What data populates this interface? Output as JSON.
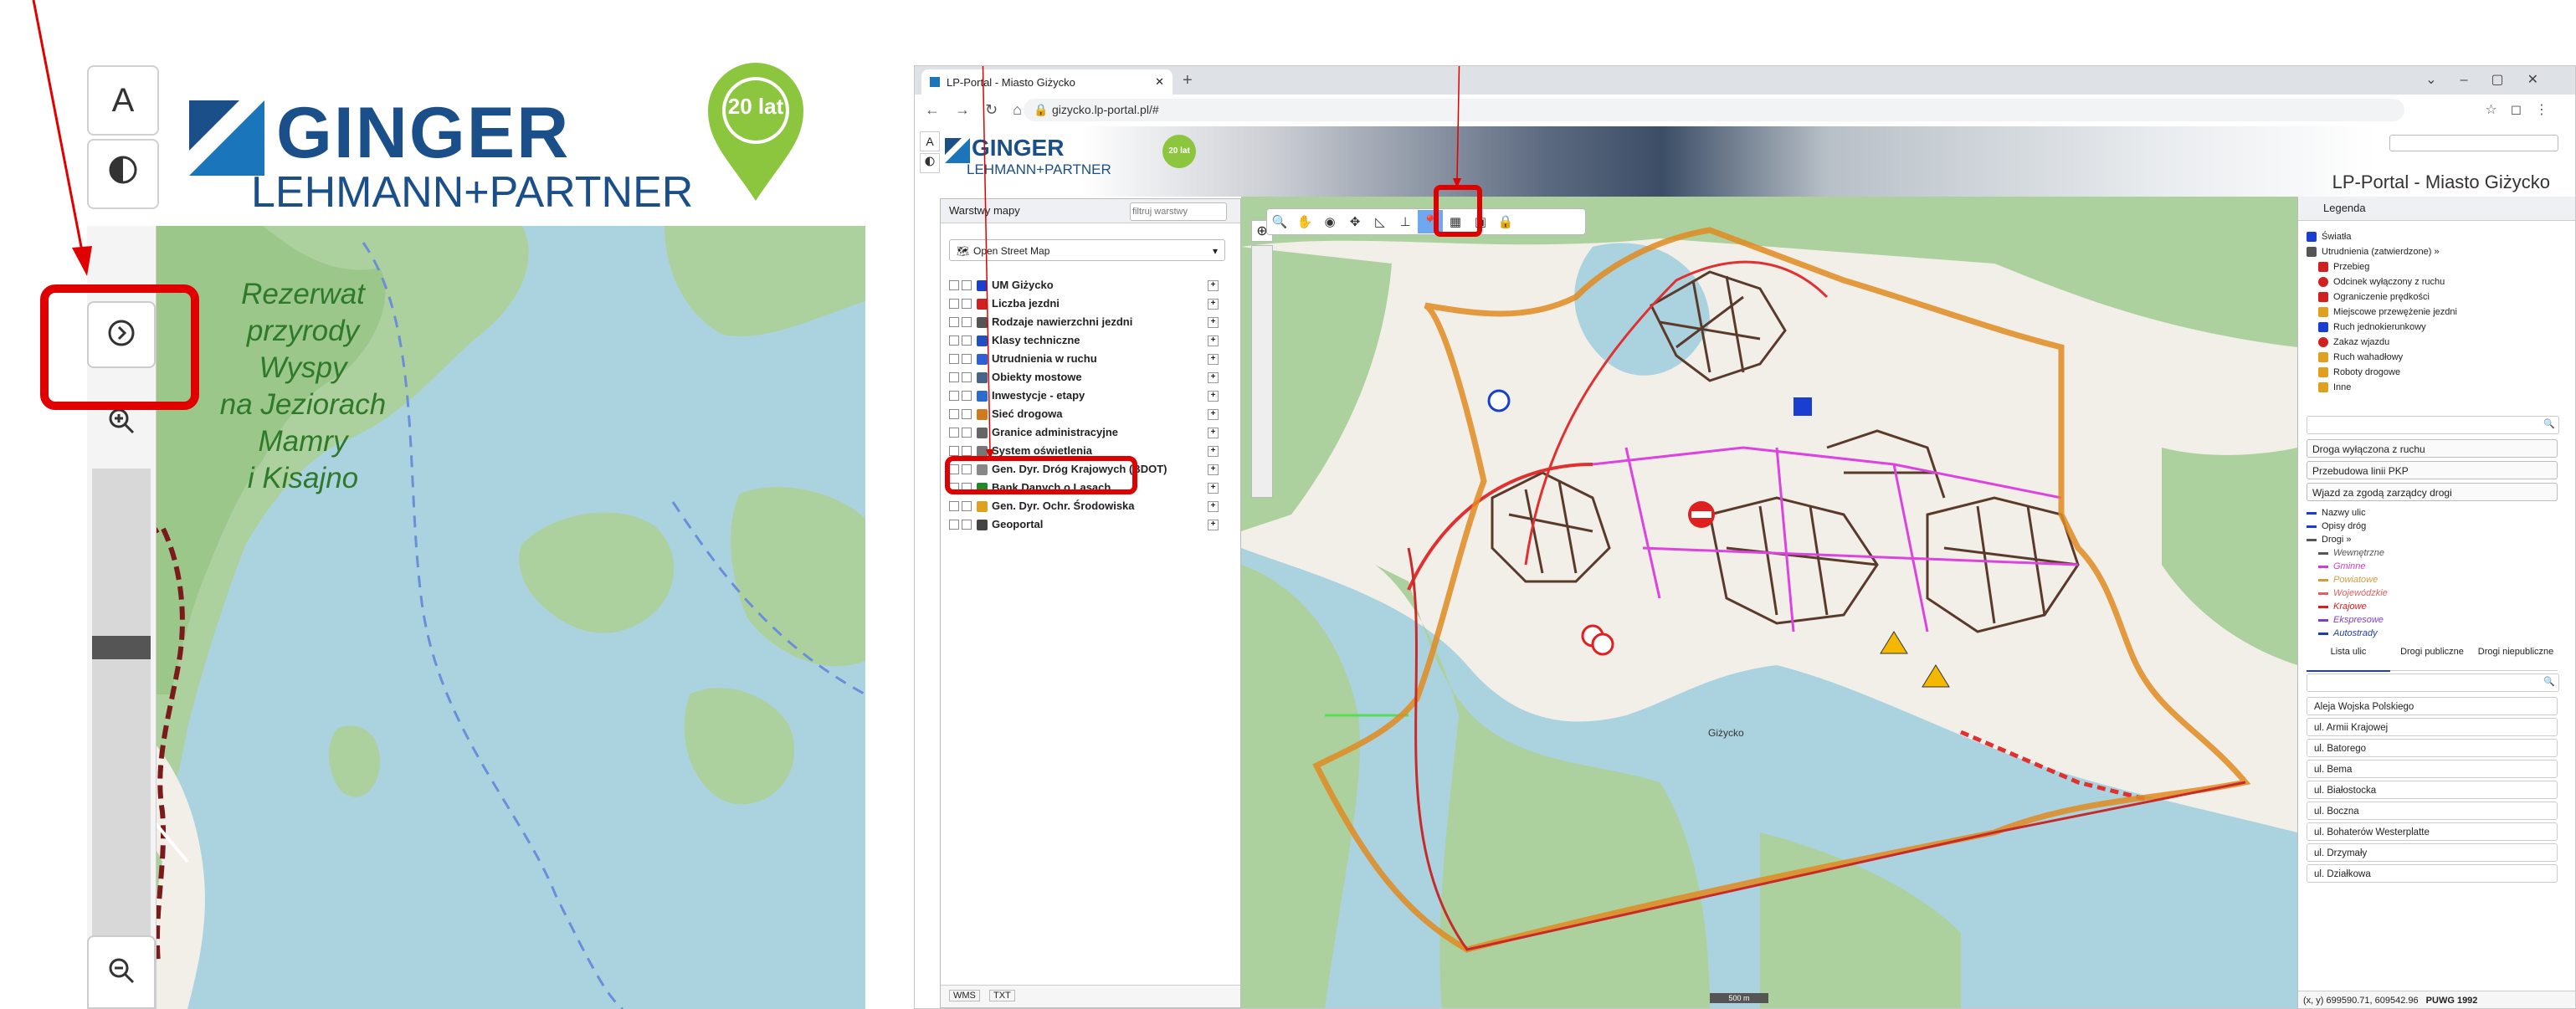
{
  "zoom": {
    "font_button": "A",
    "contrast_icon": "contrast-icon",
    "expand_icon": "chevron-right-circle-icon",
    "zoom_in_icon": "zoom-in-icon",
    "zoom_out_icon": "zoom-out-icon",
    "logo_line1": "GINGER",
    "logo_line2": "LEHMANN+PARTNER",
    "badge": "20 lat",
    "map_label": [
      "Rezerwat",
      "przyrody",
      "Wyspy",
      "na Jeziorach",
      "Mamry",
      "i Kisajno"
    ]
  },
  "browser": {
    "tab_title": "LP-Portal - Miasto Giżycko",
    "url": "gizycko.lp-portal.pl/#",
    "app_title": "LP-Portal - Miasto Giżycko"
  },
  "left_panel": {
    "title": "Warstwy mapy",
    "filter_placeholder": "filtruj warstwy",
    "basemap": "Open Street Map",
    "layers": [
      {
        "label": "UM Giżycko",
        "color": "#1a3fd0"
      },
      {
        "label": "Liczba jezdni",
        "color": "#d02020"
      },
      {
        "label": "Rodzaje nawierzchni jezdni",
        "color": "#555555"
      },
      {
        "label": "Klasy techniczne",
        "color": "#2050c0"
      },
      {
        "label": "Utrudnienia w ruchu",
        "color": "#2e5fd6"
      },
      {
        "label": "Obiekty mostowe",
        "color": "#446688"
      },
      {
        "label": "Inwestycje - etapy",
        "color": "#2b6cd0"
      },
      {
        "label": "Sieć drogowa",
        "color": "#d07a20"
      },
      {
        "label": "Granice administracyjne",
        "color": "#666666"
      },
      {
        "label": "System oświetlenia",
        "color": "#777777"
      },
      {
        "label": "Gen. Dyr. Dróg Krajowych (BDOT)",
        "color": "#888888"
      },
      {
        "label": "Bank Danych o Lasach",
        "color": "#1f8a2a"
      },
      {
        "label": "Gen. Dyr. Ochr. Środowiska",
        "color": "#e0a020"
      },
      {
        "label": "Geoportal",
        "color": "#444444"
      }
    ],
    "footer_wms": "WMS",
    "footer_txt": "TXT"
  },
  "map": {
    "town_label": "Giżycko",
    "scale_text": "500 m",
    "coords": "(x, y) 699590.71, 609542.96",
    "epsg": "PUWG 1992"
  },
  "tools": [
    "search-icon",
    "hand-icon",
    "marker-icon",
    "move-icon",
    "measure-icon",
    "ruler-icon",
    "pin-icon",
    "layers-icon",
    "print-icon",
    "lock-icon"
  ],
  "right_panel": {
    "title": "Legenda",
    "legend": [
      {
        "label": "Światła",
        "icon": "traffic-light-icon",
        "color": "#1a3fd0"
      },
      {
        "label": "Utrudnienia (zatwierdzone) »",
        "icon": "warning-icon",
        "color": "#555555"
      },
      {
        "label": "Przebieg",
        "icon": "line-icon",
        "color": "#d02020"
      },
      {
        "label": "Odcinek wyłączony z ruchu",
        "icon": "no-entry-icon",
        "color": "#d02020"
      },
      {
        "label": "Ograniczenie prędkości",
        "icon": "speed-limit-icon",
        "color": "#d02020"
      },
      {
        "label": "Miejscowe przewężenie jezdni",
        "icon": "narrowing-icon",
        "color": "#e0a020"
      },
      {
        "label": "Ruch jednokierunkowy",
        "icon": "one-way-icon",
        "color": "#1a3fd0"
      },
      {
        "label": "Zakaz wjazdu",
        "icon": "no-entry-icon",
        "color": "#d02020"
      },
      {
        "label": "Ruch wahadłowy",
        "icon": "alternating-traffic-icon",
        "color": "#e0a020"
      },
      {
        "label": "Roboty drogowe",
        "icon": "roadworks-icon",
        "color": "#e0a020"
      },
      {
        "label": "Inne",
        "icon": "warning-icon",
        "color": "#e0a020"
      }
    ],
    "filters": [
      "Droga wyłączona z ruchu",
      "Przebudowa linii PKP",
      "Wjazd za zgodą zarządcy drogi"
    ],
    "legend2": [
      {
        "label": "Nazwy ulic",
        "color": "#1a3fd0"
      },
      {
        "label": "Opisy dróg",
        "color": "#1a3fd0"
      },
      {
        "label": "Drogi »",
        "color": "#555555"
      },
      {
        "label": "Wewnętrzne",
        "color": "#555555"
      },
      {
        "label": "Gminne",
        "color": "#cc40cc"
      },
      {
        "label": "Powiatowe",
        "color": "#d0a040"
      },
      {
        "label": "Wojewódzkie",
        "color": "#e06060"
      },
      {
        "label": "Krajowe",
        "color": "#d02020"
      },
      {
        "label": "Ekspresowe",
        "color": "#8040c0"
      },
      {
        "label": "Autostrady",
        "color": "#2040a0"
      }
    ],
    "tabs": [
      "Lista ulic",
      "Drogi publiczne",
      "Drogi niepubliczne"
    ],
    "streets": [
      "Aleja Wojska Polskiego",
      "ul. Armii Krajowej",
      "ul. Batorego",
      "ul. Bema",
      "ul. Białostocka",
      "ul. Boczna",
      "ul. Bohaterów Westerplatte",
      "ul. Drzymały",
      "ul. Działkowa"
    ]
  },
  "colors": {
    "highlight": "#e00000",
    "water": "#aad3df",
    "forest": "#add19e",
    "land": "#f2efe9"
  }
}
